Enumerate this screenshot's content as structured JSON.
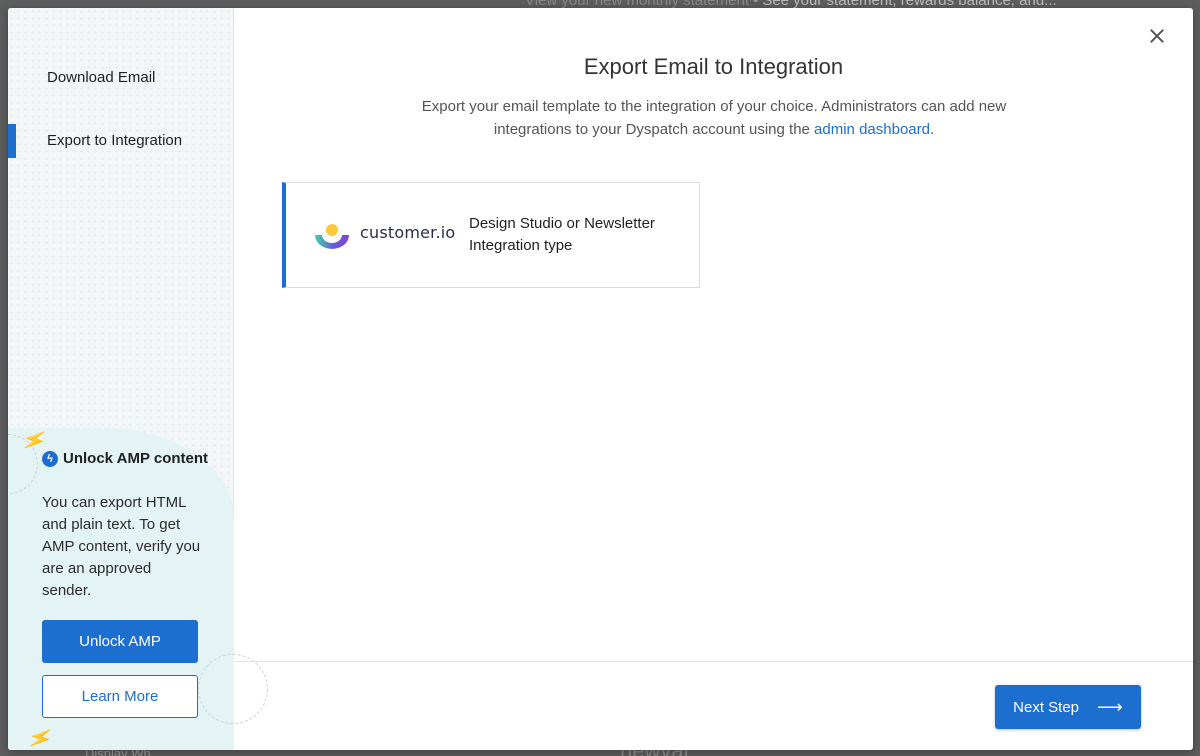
{
  "background": {
    "statement_line": "View your new monthly statement",
    "statement_detail": " - See your statement, rewards balance, and...",
    "bottom_text": "newvar",
    "bottom_left_text": "Display Wh..."
  },
  "sidebar": {
    "items": [
      {
        "label": "Download Email"
      },
      {
        "label": "Export to Integration",
        "active": true
      }
    ],
    "amp": {
      "icon": "bolt-icon",
      "title": "Unlock AMP content",
      "body": "You can export HTML and plain text. To get AMP content, verify you are an approved sender.",
      "unlock_label": "Unlock AMP",
      "learn_label": "Learn More"
    }
  },
  "main": {
    "title": "Export Email to Integration",
    "description": "Export your email template to the integration of your choice. Administrators can add new integrations to your Dyspatch account using the ",
    "description_link": "admin dashboard",
    "description_end": ".",
    "integration": {
      "logo_text": "customer.io",
      "name": "Design Studio or Newsletter",
      "type": "Integration type"
    },
    "next_label": "Next Step"
  },
  "colors": {
    "accent": "#1d6fcf",
    "sidebar_bg": "#f3f6f7",
    "amp_bg": "#e4f3f4"
  }
}
